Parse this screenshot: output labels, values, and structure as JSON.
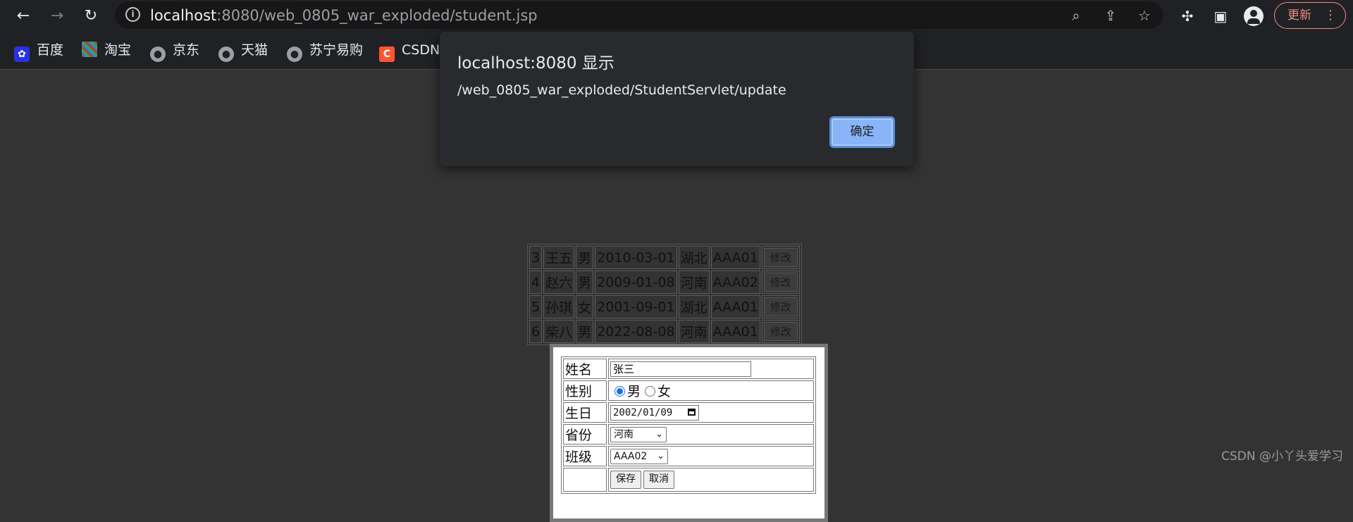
{
  "browser": {
    "url_host": "localhost",
    "url_rest": ":8080/web_0805_war_exploded/student.jsp",
    "update_label": "更新",
    "icons": [
      "back-icon",
      "forward-icon",
      "reload-icon",
      "info-icon",
      "zoom-icon",
      "share-icon",
      "star-icon",
      "extensions-icon",
      "sidepanel-icon",
      "profile-icon",
      "menu-icon"
    ]
  },
  "bookmarks": [
    {
      "label": "百度",
      "icon": "baidu-icon",
      "color": "#2932e1"
    },
    {
      "label": "淘宝",
      "icon": "taobao-icon",
      "color": "#ff5000"
    },
    {
      "label": "京东",
      "icon": "globe-icon",
      "color": "#9aa0a6"
    },
    {
      "label": "天猫",
      "icon": "globe-icon",
      "color": "#9aa0a6"
    },
    {
      "label": "苏宁易购",
      "icon": "globe-icon",
      "color": "#9aa0a6"
    },
    {
      "label": "CSDN",
      "icon": "csdn-icon",
      "color": "#fc5531"
    }
  ],
  "dialog": {
    "title": "localhost:8080 显示",
    "message": "/web_0805_war_exploded/StudentServlet/update",
    "ok_label": "确定"
  },
  "students": {
    "rows": [
      {
        "id": "3",
        "name": "王五",
        "gender": "男",
        "birthday": "2010-03-01",
        "province": "湖北",
        "class": "AAA01",
        "action": "修改"
      },
      {
        "id": "4",
        "name": "赵六",
        "gender": "男",
        "birthday": "2009-01-08",
        "province": "河南",
        "class": "AAA02",
        "action": "修改"
      },
      {
        "id": "5",
        "name": "孙琪",
        "gender": "女",
        "birthday": "2001-09-01",
        "province": "湖北",
        "class": "AAA01",
        "action": "修改"
      },
      {
        "id": "6",
        "name": "柴八",
        "gender": "男",
        "birthday": "2022-08-08",
        "province": "河南",
        "class": "AAA01",
        "action": "修改"
      }
    ]
  },
  "form": {
    "name_label": "姓名",
    "name_value": "张三",
    "gender_label": "性别",
    "gender_male": "男",
    "gender_female": "女",
    "birthday_label": "生日",
    "birthday_value": "2002/01/09",
    "province_label": "省份",
    "province_value": "河南",
    "class_label": "班级",
    "class_value": "AAA02",
    "save_label": "保存",
    "cancel_label": "取消"
  },
  "watermark": "CSDN @小丫头爱学习"
}
